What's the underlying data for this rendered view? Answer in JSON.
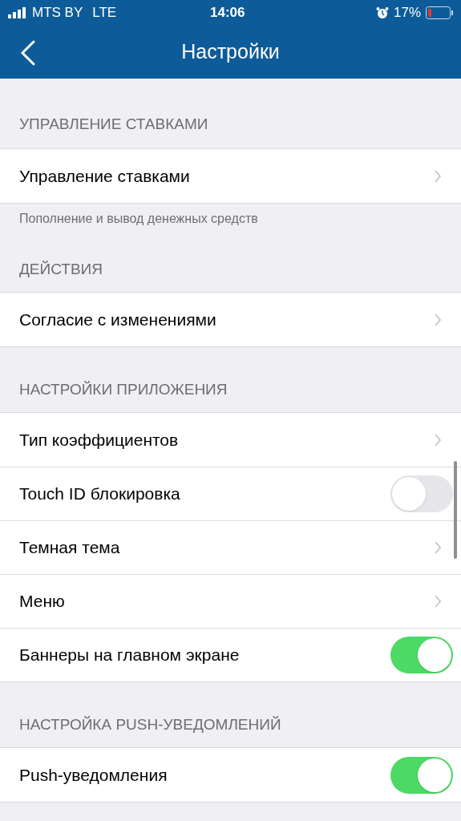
{
  "status_bar": {
    "carrier": "MTS BY",
    "network": "LTE",
    "time": "14:06",
    "battery": "17%"
  },
  "nav_bar": {
    "title": "Настройки"
  },
  "sections": [
    {
      "header": "УПРАВЛЕНИЕ СТАВКАМИ",
      "footer": "Пополнение и вывод денежных средств",
      "rows": [
        {
          "kind": "link",
          "label": "Управление ставками"
        }
      ]
    },
    {
      "header": "ДЕЙСТВИЯ",
      "rows": [
        {
          "kind": "link",
          "label": "Согласие с изменениями"
        }
      ]
    },
    {
      "header": "НАСТРОЙКИ ПРИЛОЖЕНИЯ",
      "rows": [
        {
          "kind": "link",
          "label": "Тип коэффициентов"
        },
        {
          "kind": "toggle",
          "label": "Touch ID блокировка",
          "on": false
        },
        {
          "kind": "link",
          "label": "Темная тема"
        },
        {
          "kind": "link",
          "label": "Меню"
        },
        {
          "kind": "toggle",
          "label": "Баннеры на главном экране",
          "on": true
        }
      ]
    },
    {
      "header": "НАСТРОЙКА PUSH-УВЕДОМЛЕНИЙ",
      "rows": [
        {
          "kind": "toggle",
          "label": "Push-уведомления",
          "on": true
        }
      ]
    }
  ]
}
